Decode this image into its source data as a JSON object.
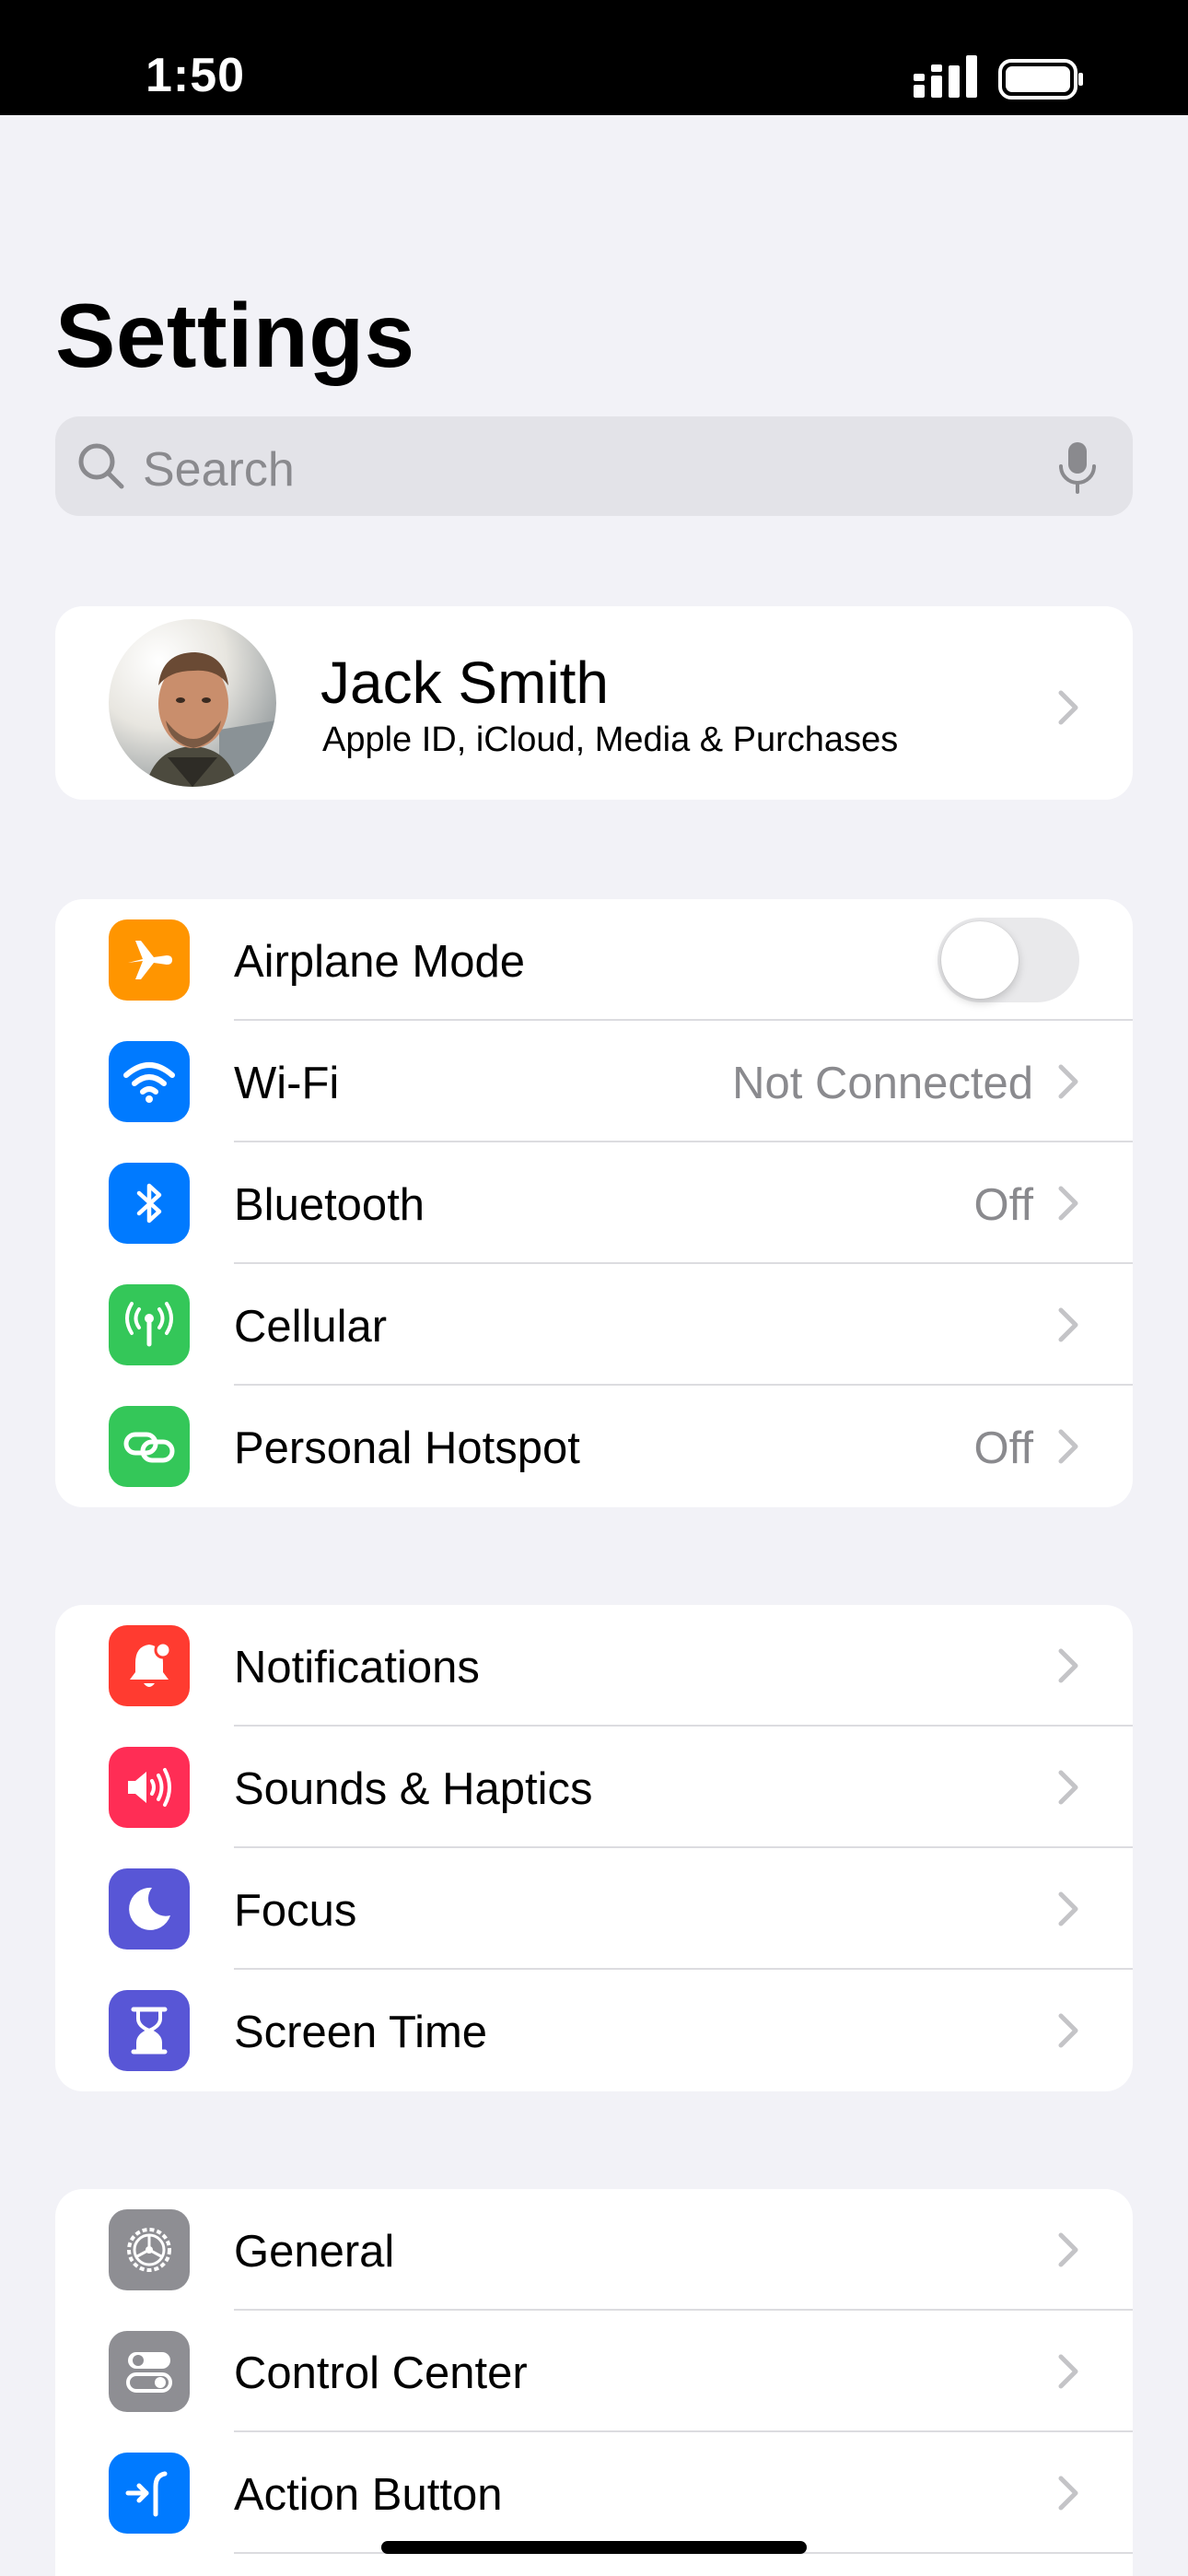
{
  "status_bar": {
    "time": "1:50"
  },
  "title": "Settings",
  "search": {
    "placeholder": "Search"
  },
  "profile": {
    "name": "Jack Smith",
    "subtitle": "Apple ID, iCloud, Media & Purchases"
  },
  "groups": [
    {
      "rows": [
        {
          "label": "Airplane Mode",
          "icon": "airplane-icon",
          "color": "#ff9500",
          "control": "toggle",
          "toggle_on": false
        },
        {
          "label": "Wi-Fi",
          "icon": "wifi-icon",
          "color": "#007aff",
          "value": "Not Connected"
        },
        {
          "label": "Bluetooth",
          "icon": "bluetooth-icon",
          "color": "#007aff",
          "value": "Off"
        },
        {
          "label": "Cellular",
          "icon": "antenna-icon",
          "color": "#34c759",
          "value": ""
        },
        {
          "label": "Personal Hotspot",
          "icon": "hotspot-link-icon",
          "color": "#34c759",
          "value": "Off"
        }
      ]
    },
    {
      "rows": [
        {
          "label": "Notifications",
          "icon": "bell-icon",
          "color": "#ff3b30"
        },
        {
          "label": "Sounds & Haptics",
          "icon": "speaker-icon",
          "color": "#ff2d55"
        },
        {
          "label": "Focus",
          "icon": "moon-icon",
          "color": "#5856d6"
        },
        {
          "label": "Screen Time",
          "icon": "hourglass-icon",
          "color": "#5856d6"
        }
      ]
    },
    {
      "rows": [
        {
          "label": "General",
          "icon": "gear-icon",
          "color": "#8e8e93"
        },
        {
          "label": "Control Center",
          "icon": "switches-icon",
          "color": "#8e8e93"
        },
        {
          "label": "Action Button",
          "icon": "action-button-icon",
          "color": "#007aff"
        }
      ]
    }
  ]
}
